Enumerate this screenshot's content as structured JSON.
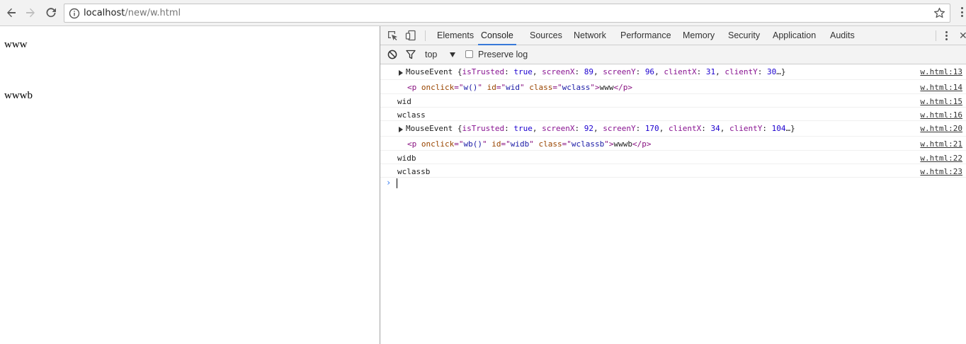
{
  "browser": {
    "url_host": "localhost",
    "url_path": "/new/w.html"
  },
  "viewport": {
    "texts": [
      "www",
      "wwwb"
    ]
  },
  "devtools": {
    "tabs": [
      "Elements",
      "Console",
      "Sources",
      "Network",
      "Performance",
      "Memory",
      "Security",
      "Application",
      "Audits"
    ],
    "active_tab": "Console",
    "context": "top",
    "preserve_log_label": "Preserve log",
    "preserve_log_checked": false
  },
  "console": {
    "messages": [
      {
        "kind": "object",
        "parts": [
          {
            "t": "MouseEvent {",
            "c": ""
          },
          {
            "t": "isTrusted",
            "c": "k"
          },
          {
            "t": ": ",
            "c": ""
          },
          {
            "t": "true",
            "c": "v"
          },
          {
            "t": ", ",
            "c": ""
          },
          {
            "t": "screenX",
            "c": "k"
          },
          {
            "t": ": ",
            "c": ""
          },
          {
            "t": "89",
            "c": "v"
          },
          {
            "t": ", ",
            "c": ""
          },
          {
            "t": "screenY",
            "c": "k"
          },
          {
            "t": ": ",
            "c": ""
          },
          {
            "t": "96",
            "c": "v"
          },
          {
            "t": ", ",
            "c": ""
          },
          {
            "t": "clientX",
            "c": "k"
          },
          {
            "t": ": ",
            "c": ""
          },
          {
            "t": "31",
            "c": "v"
          },
          {
            "t": ", ",
            "c": ""
          },
          {
            "t": "clientY",
            "c": "k"
          },
          {
            "t": ": ",
            "c": ""
          },
          {
            "t": "30",
            "c": "v"
          },
          {
            "t": "…}",
            "c": ""
          }
        ],
        "source": "w.html:13"
      },
      {
        "kind": "html",
        "parts": [
          {
            "t": "<p",
            "c": "tag"
          },
          {
            "t": " onclick",
            "c": "an"
          },
          {
            "t": "=\"",
            "c": "tag"
          },
          {
            "t": "w()",
            "c": "av"
          },
          {
            "t": "\"",
            "c": "tag"
          },
          {
            "t": " id",
            "c": "an"
          },
          {
            "t": "=\"",
            "c": "tag"
          },
          {
            "t": "wid",
            "c": "av"
          },
          {
            "t": "\"",
            "c": "tag"
          },
          {
            "t": " class",
            "c": "an"
          },
          {
            "t": "=\"",
            "c": "tag"
          },
          {
            "t": "wclass",
            "c": "av"
          },
          {
            "t": "\">",
            "c": "tag"
          },
          {
            "t": "www",
            "c": ""
          },
          {
            "t": "</p>",
            "c": "tag"
          }
        ],
        "source": "w.html:14"
      },
      {
        "kind": "text",
        "parts": [
          {
            "t": "wid",
            "c": ""
          }
        ],
        "source": "w.html:15"
      },
      {
        "kind": "text",
        "parts": [
          {
            "t": "wclass",
            "c": ""
          }
        ],
        "source": "w.html:16"
      },
      {
        "kind": "object",
        "parts": [
          {
            "t": "MouseEvent {",
            "c": ""
          },
          {
            "t": "isTrusted",
            "c": "k"
          },
          {
            "t": ": ",
            "c": ""
          },
          {
            "t": "true",
            "c": "v"
          },
          {
            "t": ", ",
            "c": ""
          },
          {
            "t": "screenX",
            "c": "k"
          },
          {
            "t": ": ",
            "c": ""
          },
          {
            "t": "92",
            "c": "v"
          },
          {
            "t": ", ",
            "c": ""
          },
          {
            "t": "screenY",
            "c": "k"
          },
          {
            "t": ": ",
            "c": ""
          },
          {
            "t": "170",
            "c": "v"
          },
          {
            "t": ", ",
            "c": ""
          },
          {
            "t": "clientX",
            "c": "k"
          },
          {
            "t": ": ",
            "c": ""
          },
          {
            "t": "34",
            "c": "v"
          },
          {
            "t": ", ",
            "c": ""
          },
          {
            "t": "clientY",
            "c": "k"
          },
          {
            "t": ": ",
            "c": ""
          },
          {
            "t": "104",
            "c": "v"
          },
          {
            "t": "…}",
            "c": ""
          }
        ],
        "source": "w.html:20"
      },
      {
        "kind": "html",
        "parts": [
          {
            "t": "<p",
            "c": "tag"
          },
          {
            "t": " onclick",
            "c": "an"
          },
          {
            "t": "=\"",
            "c": "tag"
          },
          {
            "t": "wb()",
            "c": "av"
          },
          {
            "t": "\"",
            "c": "tag"
          },
          {
            "t": " id",
            "c": "an"
          },
          {
            "t": "=\"",
            "c": "tag"
          },
          {
            "t": "widb",
            "c": "av"
          },
          {
            "t": "\"",
            "c": "tag"
          },
          {
            "t": " class",
            "c": "an"
          },
          {
            "t": "=\"",
            "c": "tag"
          },
          {
            "t": "wclassb",
            "c": "av"
          },
          {
            "t": "\">",
            "c": "tag"
          },
          {
            "t": "wwwb",
            "c": ""
          },
          {
            "t": "</p>",
            "c": "tag"
          }
        ],
        "source": "w.html:21"
      },
      {
        "kind": "text",
        "parts": [
          {
            "t": "widb",
            "c": ""
          }
        ],
        "source": "w.html:22"
      },
      {
        "kind": "text",
        "parts": [
          {
            "t": "wclassb",
            "c": ""
          }
        ],
        "source": "w.html:23"
      }
    ],
    "prompt_symbol": "›"
  },
  "colors": {
    "accent_tab_underline": "#3879d9",
    "prompt": "#367cf1"
  }
}
